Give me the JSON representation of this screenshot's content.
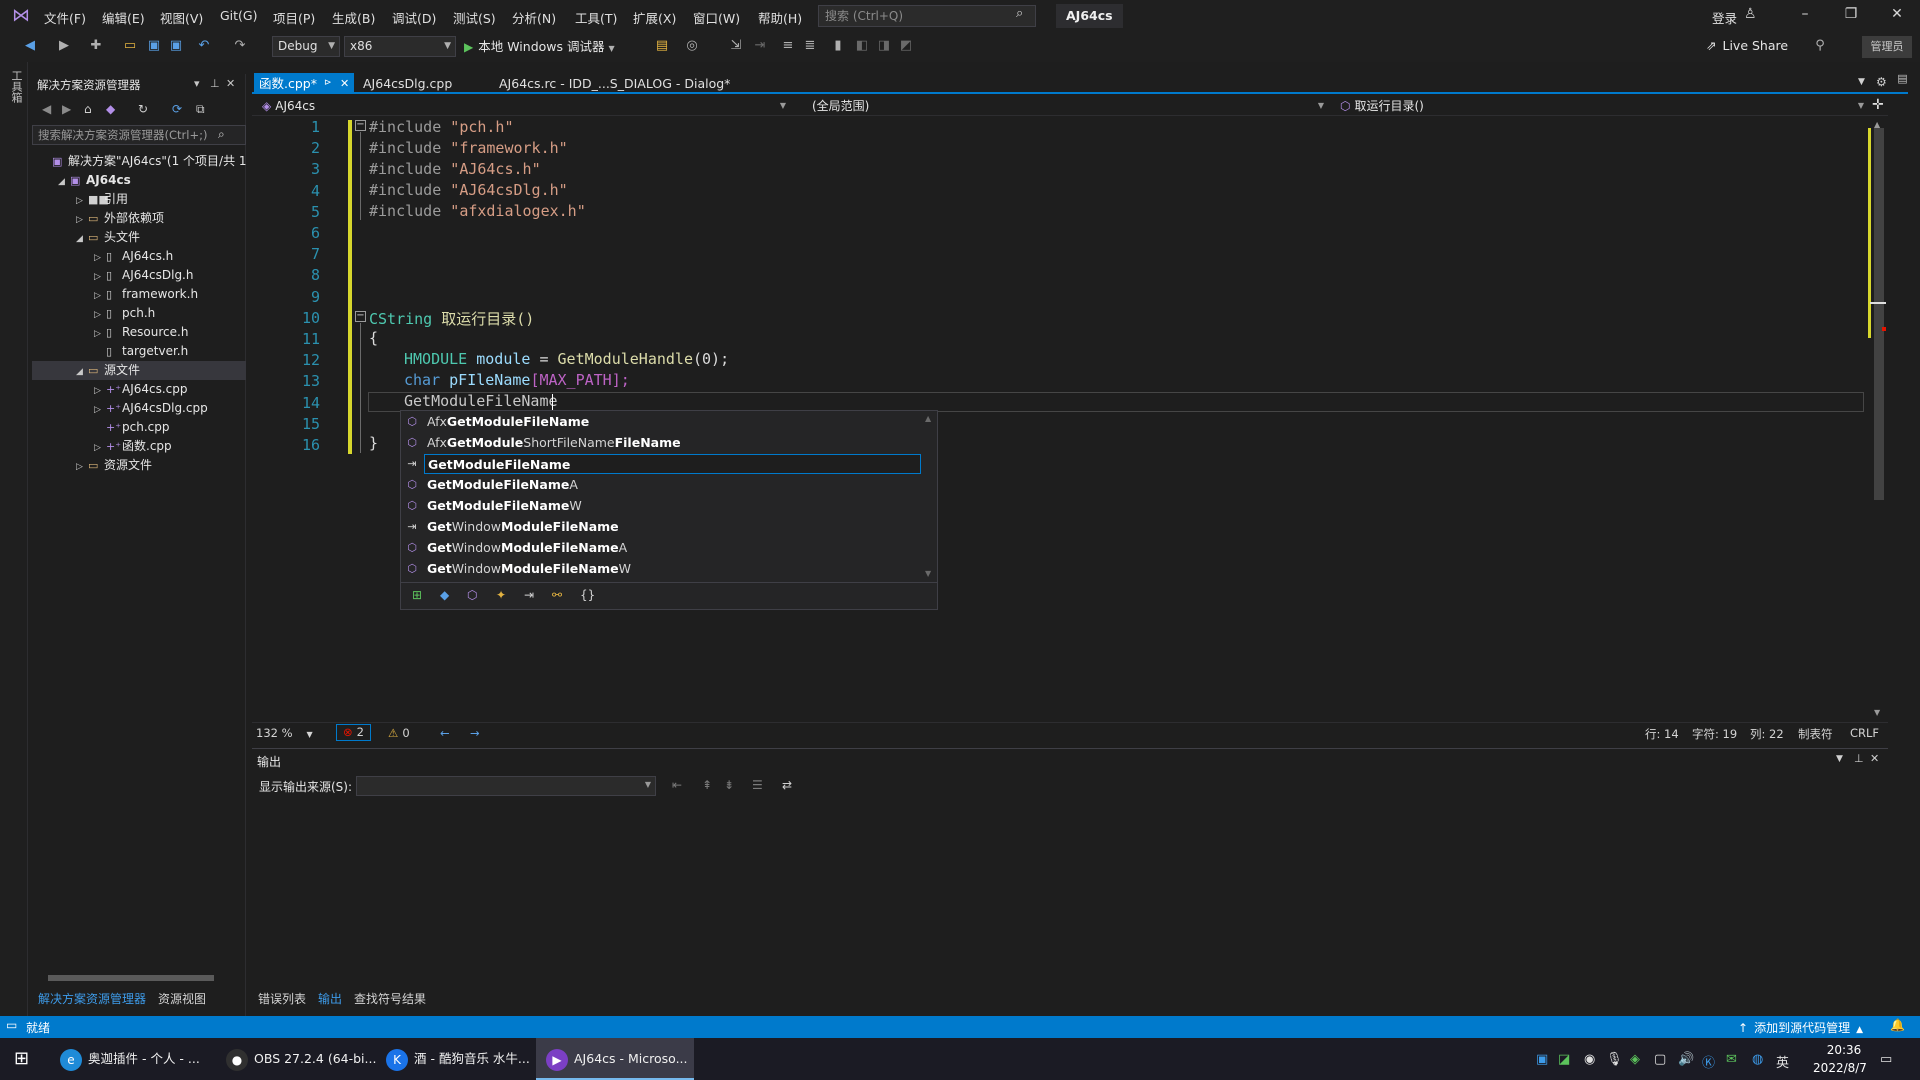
{
  "menu": {
    "items": [
      "文件(F)",
      "编辑(E)",
      "视图(V)",
      "Git(G)",
      "项目(P)",
      "生成(B)",
      "调试(D)",
      "测试(S)",
      "分析(N)",
      "工具(T)",
      "扩展(X)",
      "窗口(W)",
      "帮助(H)"
    ],
    "search_placeholder": "搜索 (Ctrl+Q)",
    "solution_name": "AJ64cs",
    "login": "登录"
  },
  "toolbar": {
    "config": "Debug",
    "platform": "x86",
    "run_label": "本地 Windows 调试器",
    "live_share": "Live Share",
    "admin": "管理员"
  },
  "left_strip": {
    "toolbox": "工具箱"
  },
  "solution_explorer": {
    "title": "解决方案资源管理器",
    "search_placeholder": "搜索解决方案资源管理器(Ctrl+;)",
    "tree": [
      {
        "label": "解决方案\"AJ64cs\"(1 个项目/共 1",
        "indent": 0,
        "arrow": "",
        "icon": "solution-icon",
        "bold": false
      },
      {
        "label": "AJ64cs",
        "indent": 1,
        "arrow": "◢",
        "icon": "project-icon",
        "bold": true
      },
      {
        "label": "引用",
        "indent": 2,
        "arrow": "▷",
        "icon": "references-icon",
        "bold": false
      },
      {
        "label": "外部依赖项",
        "indent": 2,
        "arrow": "▷",
        "icon": "folder-icon",
        "bold": false
      },
      {
        "label": "头文件",
        "indent": 2,
        "arrow": "◢",
        "icon": "folder-icon",
        "bold": false
      },
      {
        "label": "AJ64cs.h",
        "indent": 3,
        "arrow": "▷",
        "icon": "header-file-icon",
        "bold": false
      },
      {
        "label": "AJ64csDlg.h",
        "indent": 3,
        "arrow": "▷",
        "icon": "header-file-icon",
        "bold": false
      },
      {
        "label": "framework.h",
        "indent": 3,
        "arrow": "▷",
        "icon": "header-file-icon",
        "bold": false
      },
      {
        "label": "pch.h",
        "indent": 3,
        "arrow": "▷",
        "icon": "header-file-icon",
        "bold": false
      },
      {
        "label": "Resource.h",
        "indent": 3,
        "arrow": "▷",
        "icon": "header-file-icon",
        "bold": false
      },
      {
        "label": "targetver.h",
        "indent": 3,
        "arrow": "",
        "icon": "header-file-icon",
        "bold": false
      },
      {
        "label": "源文件",
        "indent": 2,
        "arrow": "◢",
        "icon": "folder-icon",
        "bold": false,
        "selected": true
      },
      {
        "label": "AJ64cs.cpp",
        "indent": 3,
        "arrow": "▷",
        "icon": "cpp-file-icon",
        "bold": false
      },
      {
        "label": "AJ64csDlg.cpp",
        "indent": 3,
        "arrow": "▷",
        "icon": "cpp-file-icon",
        "bold": false
      },
      {
        "label": "pch.cpp",
        "indent": 3,
        "arrow": "",
        "icon": "cpp-file-icon",
        "bold": false
      },
      {
        "label": "函数.cpp",
        "indent": 3,
        "arrow": "▷",
        "icon": "cpp-file-icon",
        "bold": false
      },
      {
        "label": "资源文件",
        "indent": 2,
        "arrow": "▷",
        "icon": "folder-icon",
        "bold": false
      }
    ],
    "bottom_tabs": [
      "解决方案资源管理器",
      "资源视图"
    ]
  },
  "doc_tabs": [
    {
      "label": "函数.cpp*",
      "active": true
    },
    {
      "label": "AJ64csDlg.cpp",
      "active": false
    },
    {
      "label": "AJ64cs.rc - IDD_...S_DIALOG - Dialog*",
      "active": false
    }
  ],
  "nav_bar": {
    "project": "AJ64cs",
    "scope": "(全局范围)",
    "member": "取运行目录()"
  },
  "code": {
    "line_numbers": [
      "1",
      "2",
      "3",
      "4",
      "5",
      "6",
      "7",
      "8",
      "9",
      "10",
      "11",
      "12",
      "13",
      "14",
      "15",
      "16"
    ],
    "includes": [
      "pch.h",
      "framework.h",
      "AJ64cs.h",
      "AJ64csDlg.h",
      "afxdialogex.h"
    ],
    "include_kw": "#include",
    "func_type": "CString",
    "func_name": "取运行目录()",
    "open_brace": "{",
    "close_brace": "}",
    "line12": {
      "type": "HMODULE",
      "var": "module",
      "eq": "=",
      "call": "GetModuleHandle",
      "args": "(0);"
    },
    "line13": {
      "type": "char",
      "var": "pFIleName",
      "arg": "[MAX_PATH];"
    },
    "line14": "GetModuleFileName"
  },
  "completion": {
    "items": [
      {
        "prefix": "Afx",
        "bold": "GetModuleFileName",
        "suffix": "",
        "icon": "function-icon"
      },
      {
        "prefix": "Afx",
        "bold": "GetModule",
        "suffix": "ShortFileName",
        "bold2": "FileName",
        "icon": "function-icon"
      },
      {
        "prefix": "",
        "bold": "GetModuleFileName",
        "suffix": "",
        "icon": "macro-icon",
        "selected": true
      },
      {
        "prefix": "",
        "bold": "GetModuleFileName",
        "suffix": "A",
        "icon": "function-icon"
      },
      {
        "prefix": "",
        "bold": "GetModuleFileName",
        "suffix": "W",
        "icon": "function-icon"
      },
      {
        "prefix": "",
        "bold": "Get",
        "suffix": "Window",
        "bold2": "ModuleFileName",
        "icon": "macro-icon"
      },
      {
        "prefix": "",
        "bold": "Get",
        "suffix": "Window",
        "bold2": "ModuleFileName",
        "tail": "A",
        "icon": "function-icon"
      },
      {
        "prefix": "",
        "bold": "Get",
        "suffix": "Window",
        "bold2": "ModuleFileName",
        "tail": "W",
        "icon": "function-icon"
      }
    ],
    "filter_icons": [
      "expand-icon",
      "variable-filter-icon",
      "function-filter-icon",
      "class-filter-icon",
      "macro-filter-icon",
      "enum-filter-icon",
      "namespace-filter-icon"
    ]
  },
  "editor_status": {
    "zoom": "132 %",
    "errors": "2",
    "warnings": "0",
    "line": "行: 14",
    "char": "字符: 19",
    "col": "列: 22",
    "tabs": "制表符",
    "eol": "CRLF"
  },
  "output": {
    "title": "输出",
    "source_label": "显示输出来源(S):",
    "tabs": [
      "错误列表",
      "输出",
      "查找符号结果"
    ]
  },
  "status_bar": {
    "ready": "就绪",
    "source_control": "添加到源代码管理"
  },
  "taskbar": {
    "apps": [
      {
        "label": "奥迦插件 - 个人 - ...",
        "icon": "edge-icon",
        "color": "#1f8bd8",
        "glyph": "e"
      },
      {
        "label": "OBS 27.2.4 (64-bi...",
        "icon": "obs-icon",
        "color": "#303030",
        "glyph": "●"
      },
      {
        "label": "酒 - 酷狗音乐 水牛...",
        "icon": "kugou-icon",
        "color": "#1a73e8",
        "glyph": "K"
      },
      {
        "label": "AJ64cs - Microso...",
        "icon": "visual-studio-icon",
        "color": "#7b3fc4",
        "glyph": "▶",
        "active": true
      }
    ],
    "lang": "英",
    "time": "20:36",
    "date": "2022/8/7"
  },
  "colors": {
    "accent": "#007acc",
    "keyword": "#569cd6",
    "type": "#4ec9b0",
    "string": "#d69d85",
    "change_bar": "#d7d72d"
  }
}
